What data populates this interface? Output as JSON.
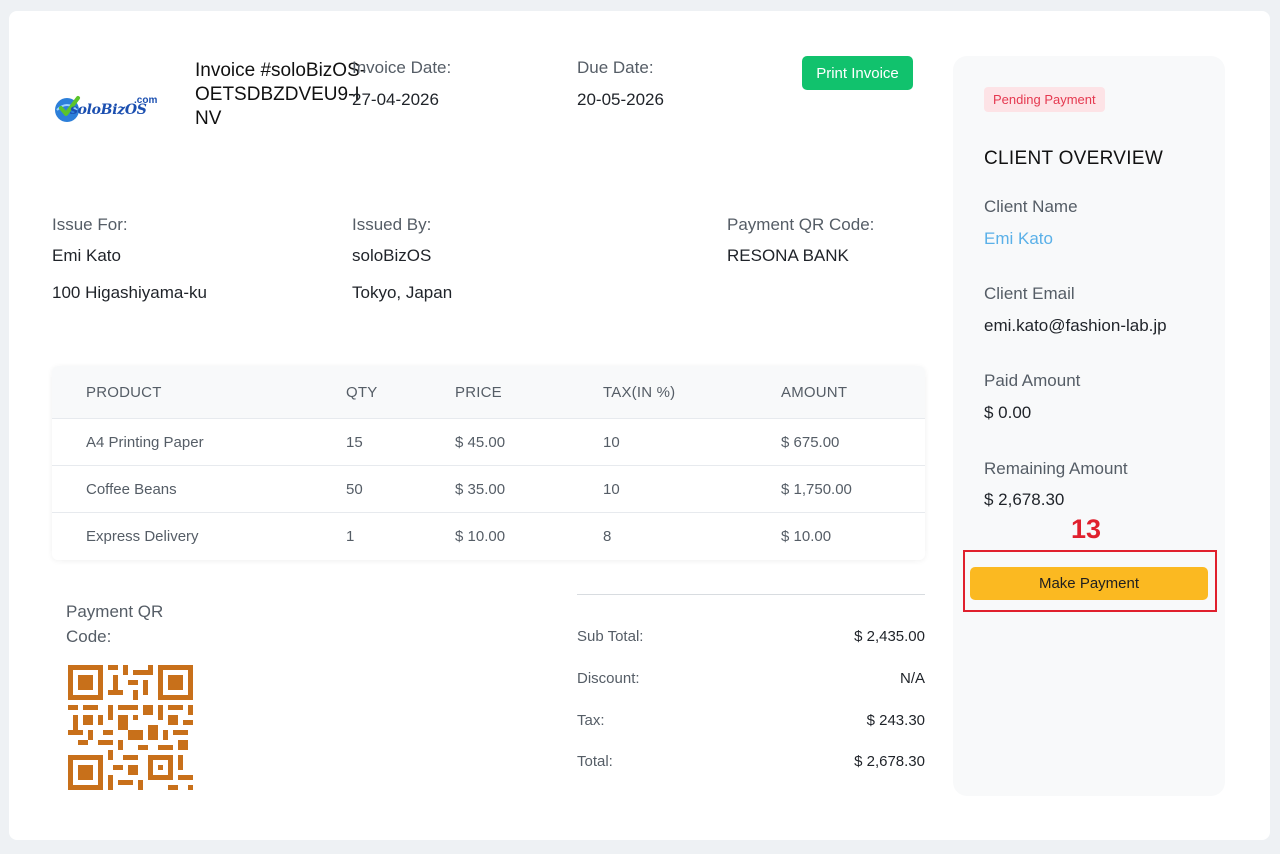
{
  "brand": {
    "logo_text": "soloBizOS",
    "logo_suffix": ".com"
  },
  "invoice": {
    "title": "Invoice #soloBizOS-OETSDBZDVEU9-INV",
    "date_label": "Invoice Date:",
    "date_value": "27-04-2026",
    "due_label": "Due Date:",
    "due_value": "20-05-2026",
    "print_label": "Print Invoice"
  },
  "parties": {
    "issue_for_label": "Issue For:",
    "issue_for_name": "Emi Kato",
    "issue_for_address": "100 Higashiyama-ku",
    "issued_by_label": "Issued By:",
    "issued_by_name": "soloBizOS",
    "issued_by_address": "Tokyo, Japan",
    "qr_code_label": "Payment QR Code:",
    "bank": "RESONA BANK"
  },
  "table": {
    "headers": [
      "PRODUCT",
      "QTY",
      "PRICE",
      "TAX(IN %)",
      "AMOUNT"
    ],
    "rows": [
      [
        "A4 Printing Paper",
        "15",
        "$ 45.00",
        "10",
        "$ 675.00"
      ],
      [
        "Coffee Beans",
        "50",
        "$ 35.00",
        "10",
        "$ 1,750.00"
      ],
      [
        "Express Delivery",
        "1",
        "$ 10.00",
        "8",
        "$ 10.00"
      ]
    ]
  },
  "qr_section": {
    "label": "Payment QR Code:"
  },
  "summary": {
    "subtotal_label": "Sub Total:",
    "subtotal_value": "$ 2,435.00",
    "discount_label": "Discount:",
    "discount_value": "N/A",
    "tax_label": "Tax:",
    "tax_value": "$ 243.30",
    "total_label": "Total:",
    "total_value": "$ 2,678.30"
  },
  "sidebar": {
    "status_badge": "Pending Payment",
    "heading": "CLIENT OVERVIEW",
    "client_name_label": "Client Name",
    "client_name_value": "Emi Kato",
    "client_email_label": "Client Email",
    "client_email_value": "emi.kato@fashion-lab.jp",
    "paid_label": "Paid Amount",
    "paid_value": "$ 0.00",
    "remaining_label": "Remaining Amount",
    "remaining_value": "$ 2,678.30",
    "pay_button": "Make Payment"
  },
  "annotation": {
    "step_number": "13"
  },
  "colors": {
    "print_button": "#11c26d",
    "pay_button": "#fbb921",
    "badge_bg": "#fde3e6",
    "badge_text": "#e53950",
    "link": "#5ab0e8",
    "highlight": "#e0202d",
    "qr": "#c8701a"
  }
}
